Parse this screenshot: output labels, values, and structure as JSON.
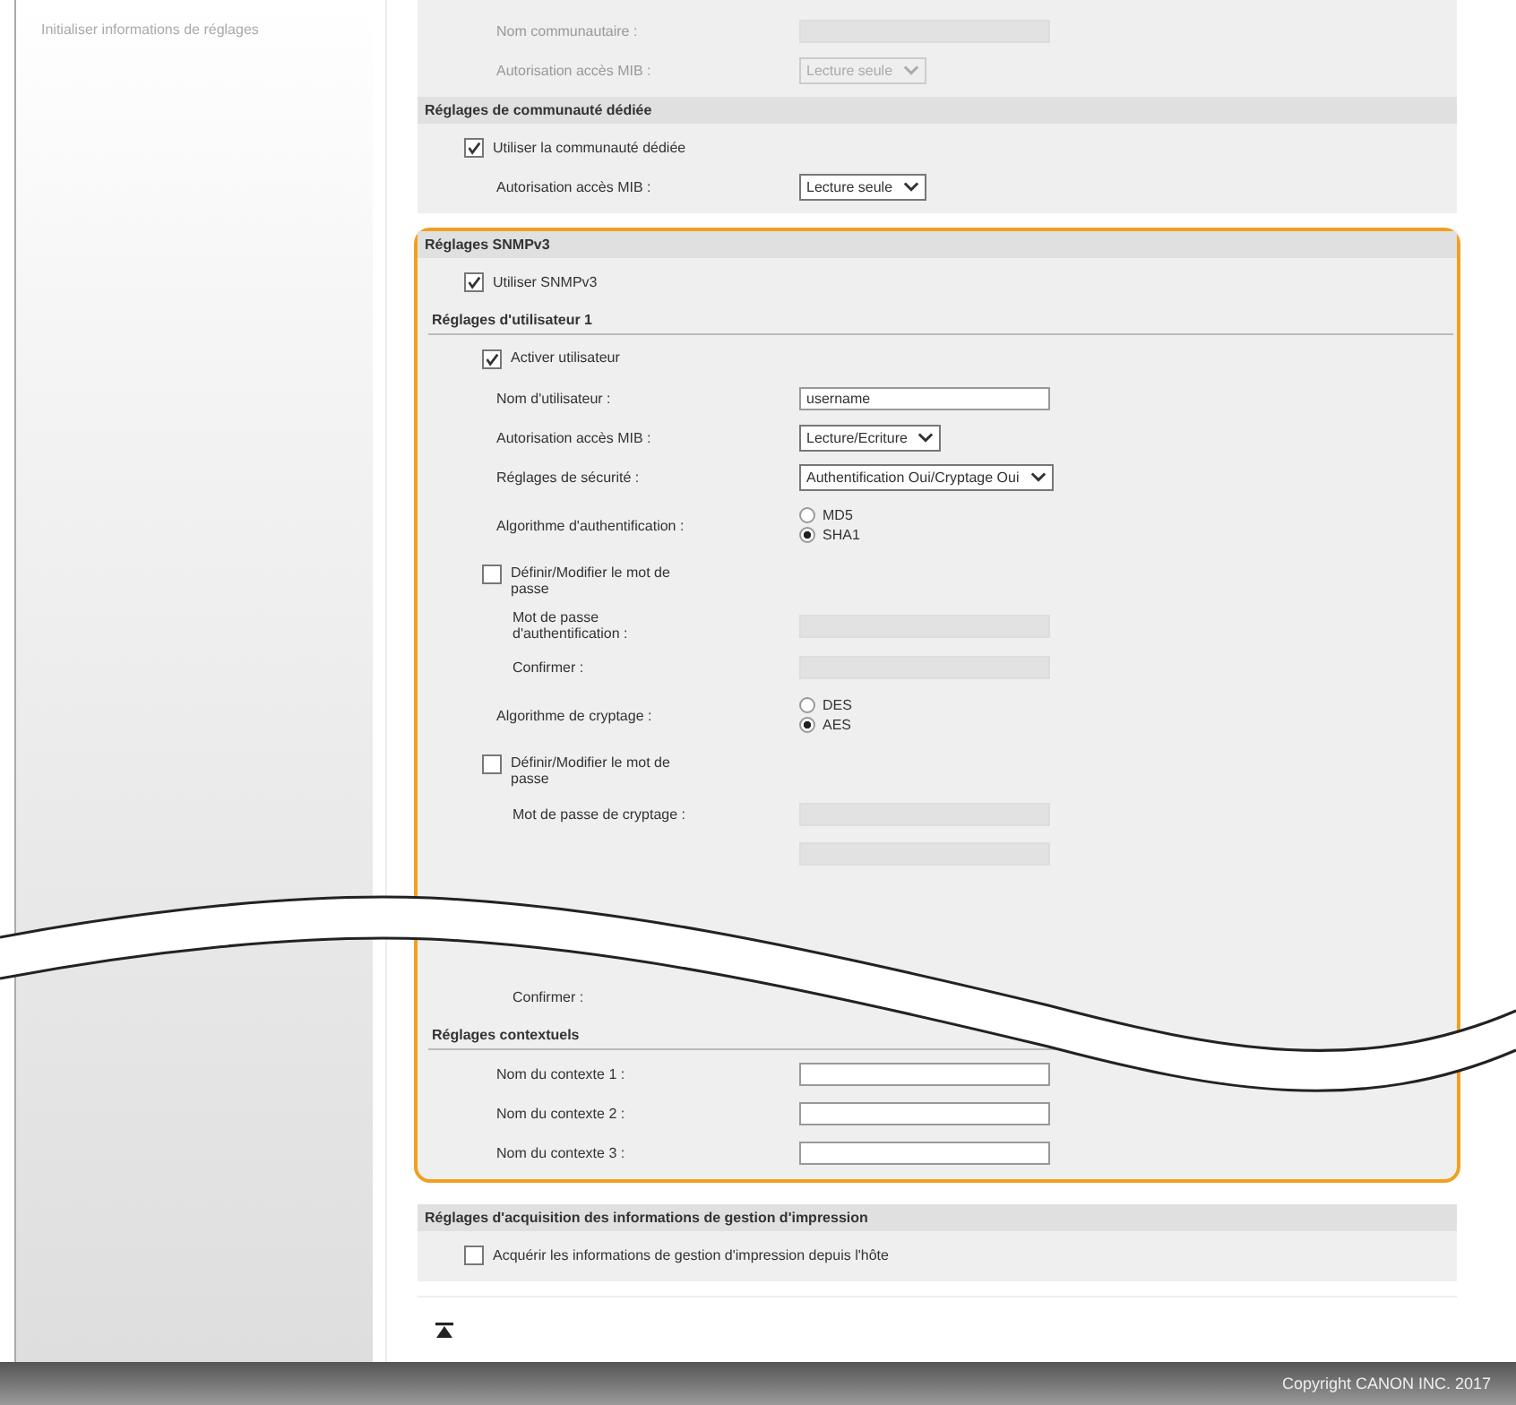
{
  "sidebar": {
    "items": [
      {
        "label": "Initialiser informations de réglages"
      }
    ]
  },
  "sections": [
    {
      "highlighted": false,
      "rows": [
        {
          "kind": "field",
          "label": "Nom communautaire :",
          "disabled": true
        },
        {
          "kind": "select",
          "label": "Autorisation accès MIB :",
          "value": "Lecture seule",
          "disabled": true
        }
      ]
    },
    {
      "heading": "Réglages de communauté dédiée",
      "highlighted": false,
      "rows": [
        {
          "kind": "checkbox",
          "label": "Utiliser la communauté dédiée",
          "checked": true
        },
        {
          "kind": "select",
          "label": "Autorisation accès MIB :",
          "value": "Lecture seule",
          "disabled": false
        }
      ]
    },
    {
      "heading": "Réglages SNMPv3",
      "highlighted": true,
      "rows": [
        {
          "kind": "checkbox",
          "label": "Utiliser SNMPv3",
          "checked": true
        }
      ],
      "subsections": [
        {
          "heading": "Réglages d'utilisateur 1",
          "rows": [
            {
              "kind": "checkbox",
              "label": "Activer utilisateur",
              "checked": true
            },
            {
              "kind": "field",
              "label": "Nom d'utilisateur :",
              "value": "username",
              "disabled": false
            },
            {
              "kind": "select",
              "label": "Autorisation accès MIB :",
              "value": "Lecture/Ecriture",
              "disabled": false
            },
            {
              "kind": "select",
              "label": "Réglages de sécurité :",
              "value": "Authentification Oui/Cryptage Oui",
              "disabled": false
            },
            {
              "kind": "radio",
              "label": "Algorithme d'authentification :",
              "options": [
                {
                  "label": "MD5",
                  "selected": false
                },
                {
                  "label": "SHA1",
                  "selected": true
                }
              ]
            },
            {
              "kind": "checkbox",
              "label": "Définir/Modifier le mot de passe",
              "checked": false,
              "children": [
                {
                  "kind": "field",
                  "label": "Mot de passe d'authentification :",
                  "disabled": true
                },
                {
                  "kind": "field",
                  "label": "Confirmer :",
                  "disabled": true
                }
              ]
            },
            {
              "kind": "radio",
              "label": "Algorithme de cryptage :",
              "options": [
                {
                  "label": "DES",
                  "selected": false
                },
                {
                  "label": "AES",
                  "selected": true
                }
              ]
            },
            {
              "kind": "checkbox",
              "label": "Définir/Modifier le mot de passe",
              "checked": false,
              "children": [
                {
                  "kind": "field",
                  "label": "Mot de passe de cryptage :",
                  "disabled": true
                },
                {
                  "kind": "field",
                  "disabled": true
                },
                {
                  "kind": "break"
                },
                {
                  "kind": "label",
                  "label": "Confirmer :"
                }
              ]
            }
          ]
        },
        {
          "heading": "Réglages contextuels",
          "rows": [
            {
              "kind": "field",
              "label": "Nom du contexte 1 :",
              "disabled": false
            },
            {
              "kind": "field",
              "label": "Nom du contexte 2 :",
              "disabled": false
            },
            {
              "kind": "field",
              "label": "Nom du contexte 3 :",
              "disabled": false
            }
          ]
        }
      ]
    },
    {
      "heading": "Réglages d'acquisition des informations de gestion d'impression",
      "highlighted": false,
      "rows": [
        {
          "kind": "checkbox",
          "label": "Acquérir les informations de gestion d'impression depuis l'hôte",
          "checked": false
        }
      ]
    }
  ],
  "footer": {
    "copyright": "Copyright CANON INC. 2017"
  }
}
